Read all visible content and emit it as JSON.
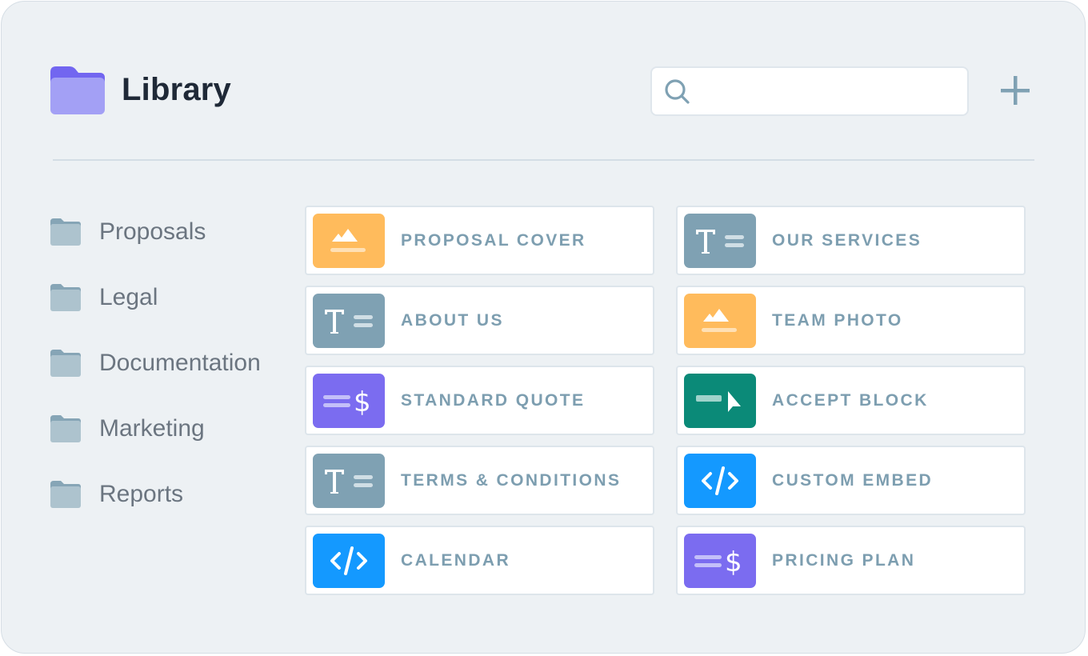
{
  "header": {
    "title": "Library",
    "search": {
      "value": "",
      "placeholder": ""
    },
    "add_button_icon": "plus-icon"
  },
  "colors": {
    "background": "#edf1f4",
    "folder_accent": "#7b6cf0",
    "label_text": "#7d9eb0",
    "tile_orange": "#ffbb5c",
    "tile_slate": "#7fa1b3",
    "tile_purple": "#7b6cf0",
    "tile_teal": "#0b8a78",
    "tile_blue": "#1499ff"
  },
  "sidebar": {
    "items": [
      {
        "label": "Proposals",
        "icon": "folder-icon"
      },
      {
        "label": "Legal",
        "icon": "folder-icon"
      },
      {
        "label": "Documentation",
        "icon": "folder-icon"
      },
      {
        "label": "Marketing",
        "icon": "folder-icon"
      },
      {
        "label": "Reports",
        "icon": "folder-icon"
      }
    ]
  },
  "blocks": {
    "left": [
      {
        "label": "PROPOSAL COVER",
        "icon": "image-icon"
      },
      {
        "label": "ABOUT US",
        "icon": "text-icon"
      },
      {
        "label": "STANDARD QUOTE",
        "icon": "quote-icon"
      },
      {
        "label": "TERMS & CONDITIONS",
        "icon": "text-icon"
      },
      {
        "label": "CALENDAR",
        "icon": "code-icon"
      }
    ],
    "right": [
      {
        "label": "OUR SERVICES",
        "icon": "text-icon"
      },
      {
        "label": "TEAM PHOTO",
        "icon": "image-icon"
      },
      {
        "label": "ACCEPT BLOCK",
        "icon": "accept-icon"
      },
      {
        "label": "CUSTOM EMBED",
        "icon": "code-icon"
      },
      {
        "label": "PRICING PLAN",
        "icon": "quote-icon"
      }
    ]
  }
}
